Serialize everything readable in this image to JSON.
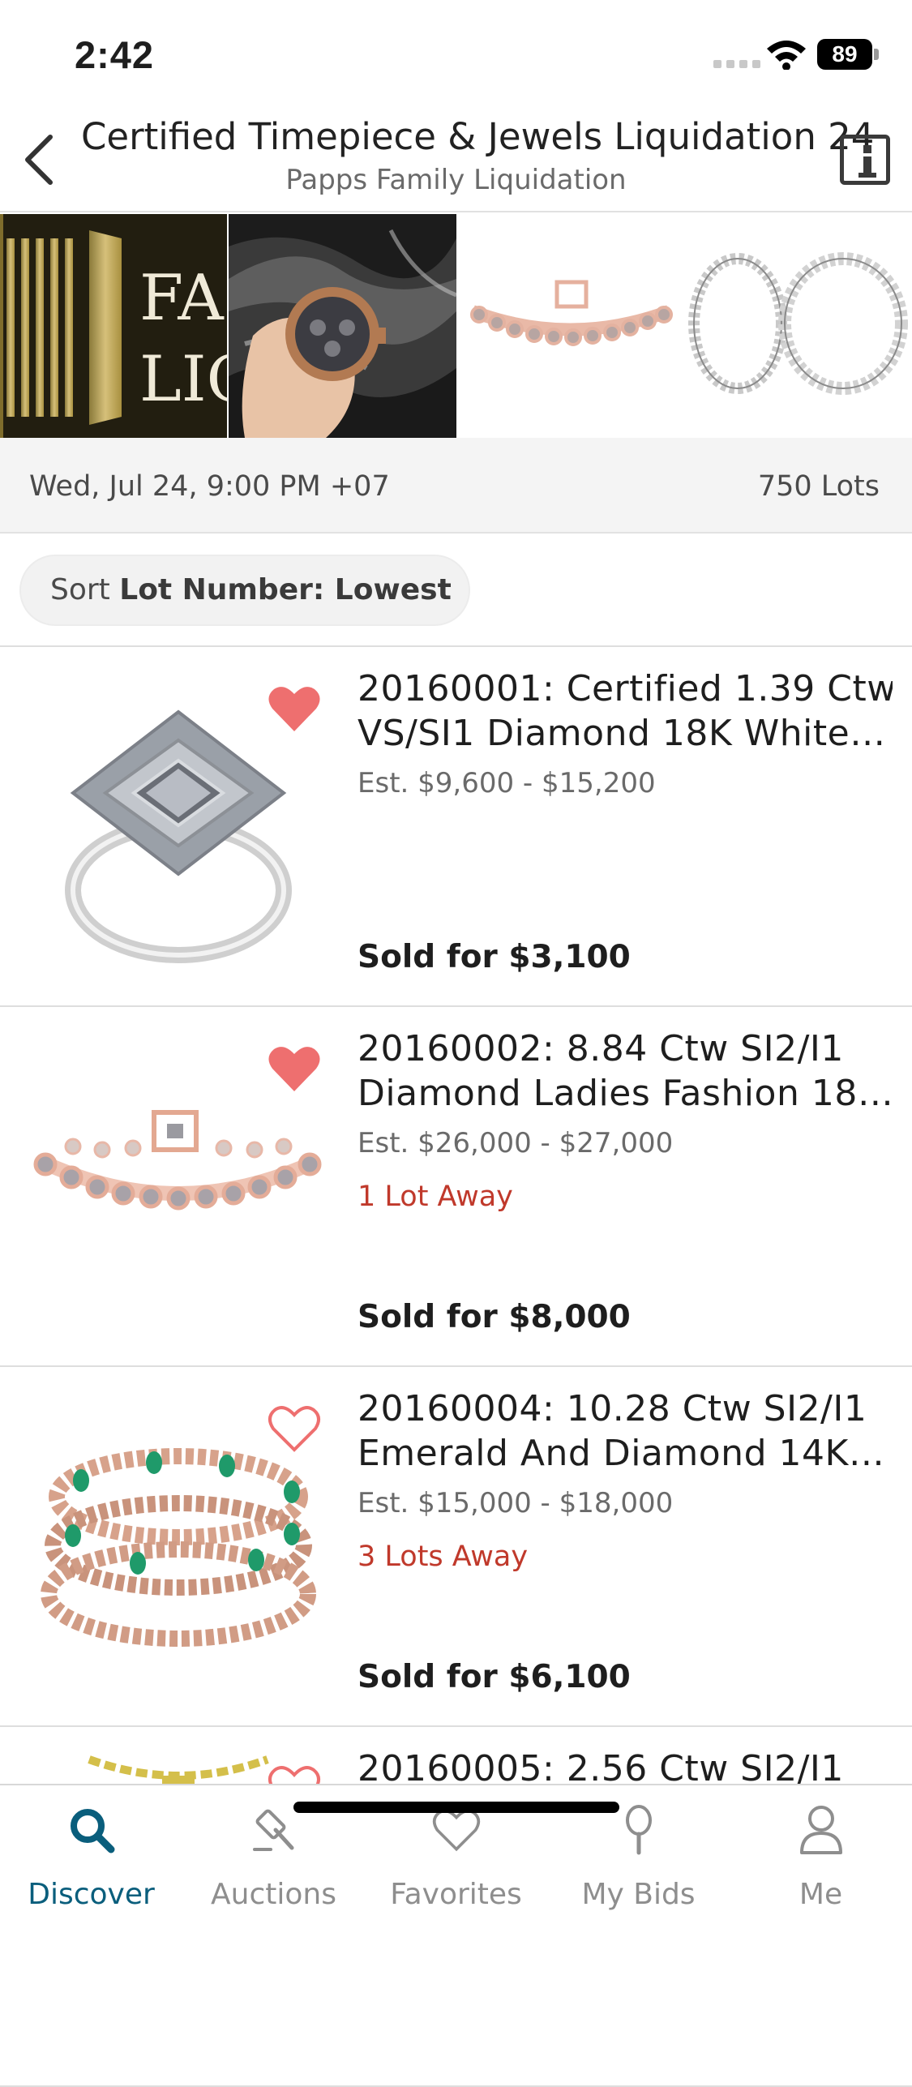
{
  "status": {
    "time": "2:42",
    "battery": "89"
  },
  "header": {
    "title": "Certified Timepiece & Jewels Liquidation 24",
    "subtitle": "Papps Family Liquidation"
  },
  "gallery": {
    "logo_text_1": "FA",
    "logo_text_2": "LIQ"
  },
  "auction_info": {
    "date": "Wed, Jul 24, 9:00 PM +07",
    "lots": "750 Lots"
  },
  "sort": {
    "prefix": "Sort",
    "value": "Lot Number: Lowest"
  },
  "lots": [
    {
      "title_line1": "20160001: Certified 1.39 Ctw",
      "title_line2": "VS/SI1 Diamond 18K White…",
      "estimate": "Est. $9,600 - $15,200",
      "away": "",
      "sold": "Sold for $3,100",
      "favorited": true
    },
    {
      "title_line1": "20160002: 8.84 Ctw SI2/I1",
      "title_line2": "Diamond Ladies Fashion 18…",
      "estimate": "Est. $26,000 - $27,000",
      "away": "1 Lot Away",
      "sold": "Sold for $8,000",
      "favorited": true
    },
    {
      "title_line1": "20160004: 10.28 Ctw SI2/I1",
      "title_line2": "Emerald And Diamond 14K…",
      "estimate": "Est. $15,000 - $18,000",
      "away": "3 Lots Away",
      "sold": "Sold for $6,100",
      "favorited": false
    },
    {
      "title_line1": "20160005: 2.56 Ctw SI2/I1",
      "title_line2": "",
      "estimate": "",
      "away": "",
      "sold": "",
      "favorited": false
    }
  ],
  "tabs": [
    {
      "label": "Discover",
      "icon": "search-icon",
      "active": true
    },
    {
      "label": "Auctions",
      "icon": "gavel-icon",
      "active": false
    },
    {
      "label": "Favorites",
      "icon": "heart-icon",
      "active": false
    },
    {
      "label": "My Bids",
      "icon": "paddle-icon",
      "active": false
    },
    {
      "label": "Me",
      "icon": "person-icon",
      "active": false
    }
  ],
  "colors": {
    "accent": "#0a5e7c",
    "heart": "#ee6f6f",
    "away": "#c0392b"
  }
}
